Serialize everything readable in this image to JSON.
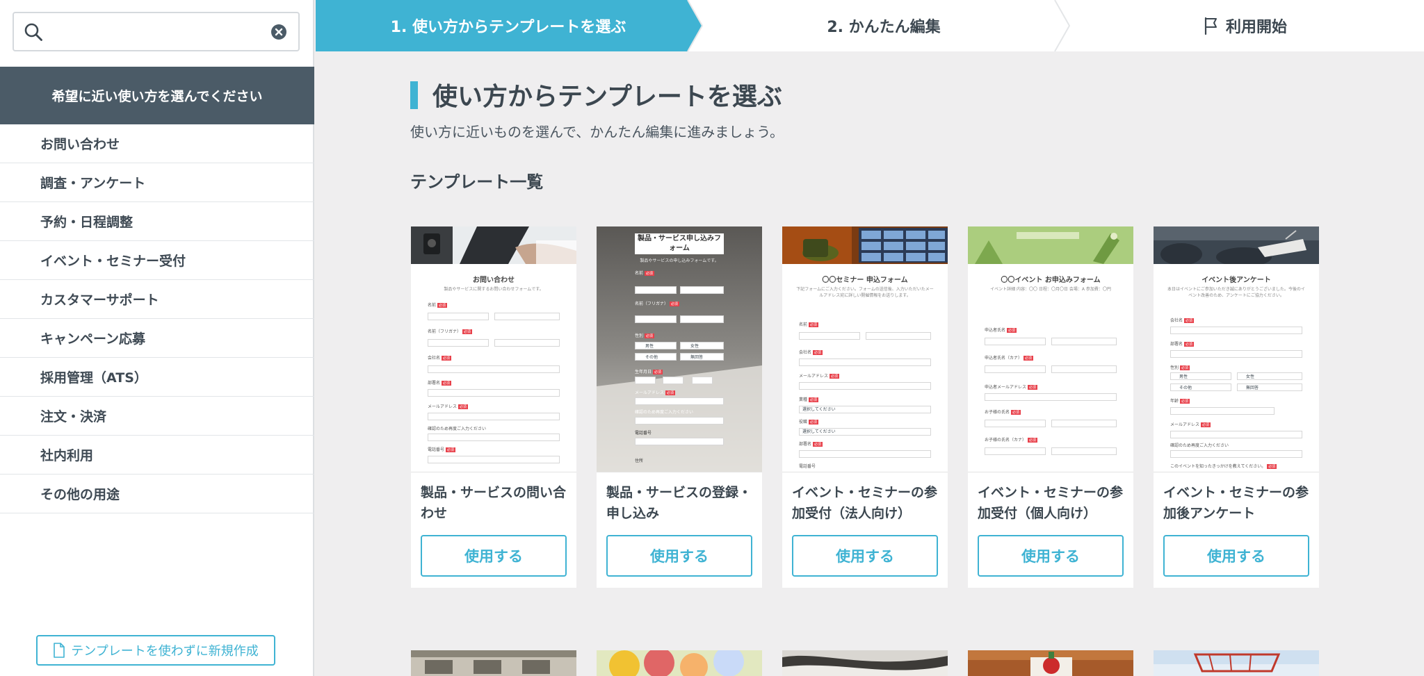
{
  "search": {
    "placeholder": ""
  },
  "sidebar": {
    "header": "希望に近い使い方を選んでください",
    "items": [
      {
        "label": "お問い合わせ"
      },
      {
        "label": "調査・アンケート"
      },
      {
        "label": "予約・日程調整"
      },
      {
        "label": "イベント・セミナー受付"
      },
      {
        "label": "カスタマーサポート"
      },
      {
        "label": "キャンペーン応募"
      },
      {
        "label": "採用管理（ATS）"
      },
      {
        "label": "注文・決済"
      },
      {
        "label": "社内利用"
      },
      {
        "label": "その他の用途"
      }
    ],
    "new_button": "テンプレートを使わずに新規作成"
  },
  "steps": {
    "step1": "1. 使い方からテンプレートを選ぶ",
    "step2": "2. かんたん編集",
    "step3": "利用開始"
  },
  "main": {
    "title": "使い方からテンプレートを選ぶ",
    "subtitle": "使い方に近いものを選んで、かんたん編集に進みましょう。",
    "section_title": "テンプレート一覧"
  },
  "templates": [
    {
      "name": "製品・サービスの問い合わせ",
      "button": "使用する",
      "form_title": "お問い合わせ",
      "form_desc": "製品やサービスに関するお問い合わせフォームです。",
      "fields": [
        "名前",
        "名前（フリガナ）",
        "会社名",
        "部署名",
        "メールアドレス",
        "確認のため再度ご入力ください",
        "電話番号"
      ]
    },
    {
      "name": "製品・サービスの登録・申し込み",
      "button": "使用する",
      "form_title": "製品・サービス申し込みフォーム",
      "form_desc": "製品やサービスの申し込みフォームです。",
      "fields": [
        "名前",
        "名前（フリガナ）",
        "性別",
        "生年月日",
        "メールアドレス",
        "確認のため再度ご入力ください",
        "電話番号",
        "住所"
      ],
      "options": [
        "男性",
        "女性",
        "その他",
        "無回答"
      ]
    },
    {
      "name": "イベント・セミナーの参加受付（法人向け）",
      "button": "使用する",
      "form_title": "〇〇セミナー 申込フォーム",
      "form_desc": "下記フォームにご入力ください。フォームの送信後、入力いただいたメールアドレス宛に詳しい開催情報をお送りします。",
      "fields": [
        "名前",
        "会社名",
        "メールアドレス",
        "業種",
        "役職",
        "部署名",
        "電話番号"
      ],
      "select_placeholder": "選択してください"
    },
    {
      "name": "イベント・セミナーの参加受付（個人向け）",
      "button": "使用する",
      "form_title": "〇〇イベント お申込みフォーム",
      "form_desc": "イベント詳細 内容：〇〇 日程：〇月〇日 会場：A 参加費：〇円",
      "fields": [
        "申込者氏名",
        "申込者氏名（カナ）",
        "申込者メールアドレス",
        "お子様の氏名",
        "お子様の氏名（カナ）"
      ]
    },
    {
      "name": "イベント・セミナーの参加後アンケート",
      "button": "使用する",
      "form_title": "イベント後アンケート",
      "form_desc": "本日はイベントにご参加いただき誠にありがとうございました。今後のイベント改善のため、アンケートにご協力ください。",
      "fields": [
        "会社名",
        "部署名",
        "性別",
        "年齢",
        "メールアドレス",
        "確認のため再度ご入力ください",
        "このイベントを知ったきっかけを教えてください。"
      ],
      "options": [
        "男性",
        "女性",
        "その他",
        "無回答"
      ]
    }
  ],
  "colors": {
    "accent": "#3fb3d3",
    "sidebar_header": "#4b5b67",
    "required": "#e8404a",
    "background": "#efeeef"
  }
}
